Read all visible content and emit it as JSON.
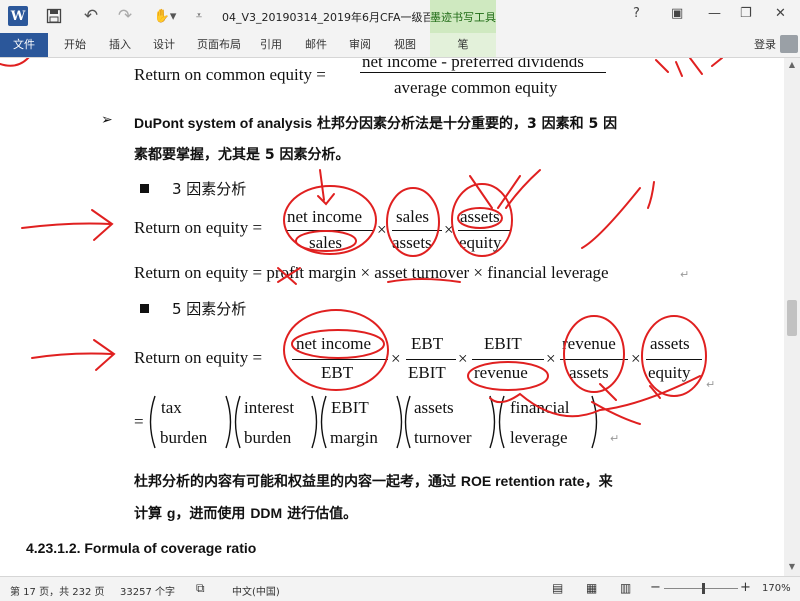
{
  "titlebar": {
    "doc_title": "04_V3_20190314_2019年6月CFA一级百题预...",
    "context_tab_title": "墨迹书写工具",
    "help": "?",
    "minimize": "—",
    "restore": "❐",
    "close": "✕",
    "ribbon_display": "▣"
  },
  "ribbon": {
    "tabs": [
      "文件",
      "开始",
      "插入",
      "设计",
      "页面布局",
      "引用",
      "邮件",
      "审阅",
      "视图",
      "笔"
    ],
    "login": "登录"
  },
  "document": {
    "roce_label": "Return on common equity =",
    "roce_num": "net income - preferred dividends",
    "roce_den": "average common equity",
    "dupont_heading": "DuPont system of analysis",
    "dupont_text_1": " 杜邦分因素分析法是十分重要的，3 因素和 5 因",
    "dupont_text_2": "素都要掌握，尤其是 5 因素分析。",
    "three_factor": "3 因素分析",
    "five_factor": "5 因素分析",
    "roe_label": "Return on equity =",
    "roe_label_5": "Return on equity =",
    "f3": [
      {
        "num": "net income",
        "den": "sales"
      },
      {
        "num": "sales",
        "den": "assets"
      },
      {
        "num": "assets",
        "den": "equity"
      }
    ],
    "roe_words": "Return on equity = profit margin × asset turnover × financial leverage",
    "f5": [
      {
        "num": "net income",
        "den": "EBT"
      },
      {
        "num": "EBT",
        "den": "EBIT"
      },
      {
        "num": "EBIT",
        "den": "revenue"
      },
      {
        "num": "revenue",
        "den": "assets"
      },
      {
        "num": "assets",
        "den": "equity"
      }
    ],
    "times": "×",
    "equals": "=",
    "p5": [
      {
        "top": "tax",
        "bottom": "burden"
      },
      {
        "top": "interest",
        "bottom": "burden"
      },
      {
        "top": "EBIT",
        "bottom": "margin"
      },
      {
        "top": "assets",
        "bottom": "turnover"
      },
      {
        "top": "financial",
        "bottom": "leverage"
      }
    ],
    "analysis_1a": "杜邦分析的内容有可能和权益里的内容一起考，通过 ",
    "analysis_1b": "ROE retention rate",
    "analysis_1c": "，来",
    "analysis_2a": "计算 ",
    "analysis_2b": "g",
    "analysis_2c": "，进而使用 ",
    "analysis_2d": "DDM",
    "analysis_2e": " 进行估值。",
    "section_heading": "4.23.1.2.  Formula of coverage ratio",
    "bullet_arrow": "➢",
    "ink_color": "#e02020"
  },
  "statusbar": {
    "page": "第 17 页，共 232 页",
    "words": "33257 个字",
    "language": "中文(中国)",
    "zoom_minus": "−",
    "zoom_plus": "+",
    "zoom": "170%"
  }
}
